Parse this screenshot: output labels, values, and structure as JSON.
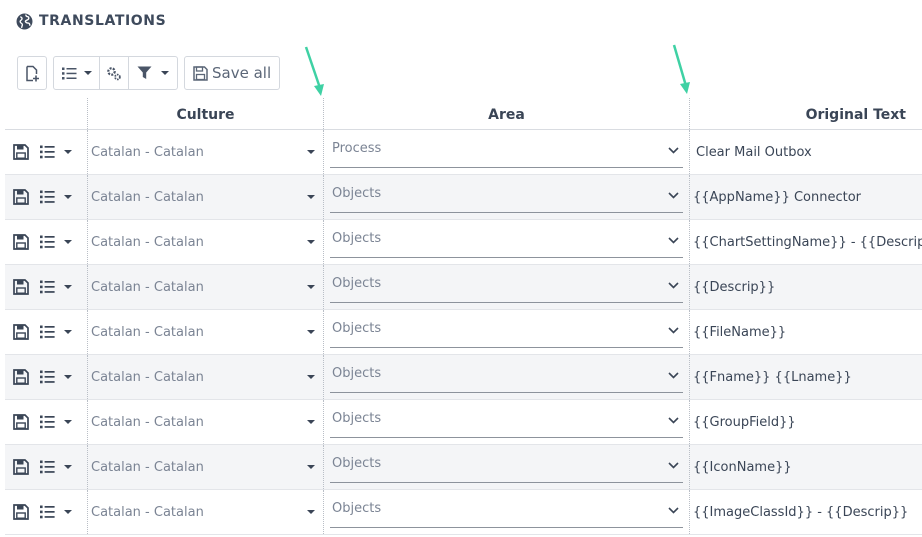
{
  "page": {
    "title": "TRANSLATIONS"
  },
  "toolbar": {
    "new_icon": "file-plus-icon",
    "list_icon": "list-icon",
    "settings_icon": "gears-icon",
    "filter_icon": "filter-icon",
    "save_all_label": "Save all"
  },
  "colors": {
    "arrow": "#3fd1a4",
    "header_text": "#3a4556",
    "row_alt": "#f4f5f7"
  },
  "columns": {
    "culture": "Culture",
    "area": "Area",
    "original_text": "Original Text"
  },
  "rows": [
    {
      "culture": "Catalan - Catalan",
      "area": "Process",
      "text": "Clear Mail Outbox"
    },
    {
      "culture": "Catalan - Catalan",
      "area": "Objects",
      "text": "{{AppName}} Connector"
    },
    {
      "culture": "Catalan - Catalan",
      "area": "Objects",
      "text": "{{ChartSettingName}} - {{Descrip}}"
    },
    {
      "culture": "Catalan - Catalan",
      "area": "Objects",
      "text": "{{Descrip}}"
    },
    {
      "culture": "Catalan - Catalan",
      "area": "Objects",
      "text": "{{FileName}}"
    },
    {
      "culture": "Catalan - Catalan",
      "area": "Objects",
      "text": "{{Fname}} {{Lname}}"
    },
    {
      "culture": "Catalan - Catalan",
      "area": "Objects",
      "text": "{{GroupField}}"
    },
    {
      "culture": "Catalan - Catalan",
      "area": "Objects",
      "text": "{{IconName}}"
    },
    {
      "culture": "Catalan - Catalan",
      "area": "Objects",
      "text": "{{ImageClassId}} - {{Descrip}}"
    }
  ]
}
